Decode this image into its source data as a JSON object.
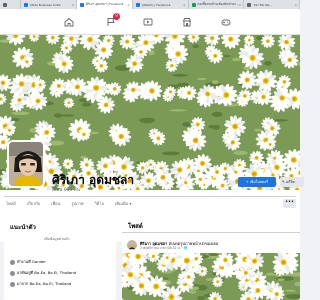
{
  "browser": {
    "tabs": [
      {
        "title": "",
        "fav_color": "#5f6368",
        "active": false
      },
      {
        "title": "Meta Business Suite",
        "fav_color": "#1877f2",
        "active": false
      },
      {
        "title": "ศิริเภา อุดมชลา | Facebook",
        "fav_color": "#1877f2",
        "active": true
      },
      {
        "title": "(Watch) | Facebook",
        "fav_color": "#1877f2",
        "active": false
      },
      {
        "title": "กองซื้อขายบ้าน/ห้องพักเช่าหา...",
        "fav_color": "#0f9d58",
        "active": false
      },
      {
        "title": "Tiki Tok Ne...",
        "fav_color": "#5f6368",
        "active": false
      }
    ]
  },
  "header": {
    "nav": [
      {
        "icon": "home-icon",
        "active": false
      },
      {
        "icon": "flag-icon",
        "badge": "9",
        "active": false
      },
      {
        "icon": "video-icon",
        "active": false
      },
      {
        "icon": "store-icon",
        "active": false
      },
      {
        "icon": "gaming-icon",
        "active": false
      }
    ]
  },
  "profile": {
    "name": "ศิริเภา อุดมชลา",
    "friends": "เพื่อน 655 คน",
    "add_story": "+ เพิ่มในสตอรี่",
    "edit": "✎ แก้ไข"
  },
  "tabs": [
    "โพสต์",
    "เกี่ยวกับ",
    "เพื่อน",
    "รูปภาพ",
    "วิดีโอ",
    "เพิ่มเติม ▾"
  ],
  "more_button": "•••",
  "intro": {
    "title": "แนะนำตัว",
    "add_bio": "เพิ่มข้อมูลส่วนตัว",
    "rows": [
      "ทำงานที่ Gander",
      "อาศัยอยู่ที่ Bo-Ea, Bo Ei, Thailand",
      "มาจาก Bo-Ea, Bo Ei, Thailand"
    ]
  },
  "posts": {
    "title": "โพสต์",
    "author": "ศิริเภา อุดมชลา",
    "author_action": "อัปเดตรูปภาพหน้าปกของเธอ",
    "time": "2 พฤศจิกายน เวลา 08:32 น. · 🌐"
  },
  "colors": {
    "brand": "#1877f2",
    "button_primary": "#1b74e4",
    "badge": "#e41e3f"
  }
}
